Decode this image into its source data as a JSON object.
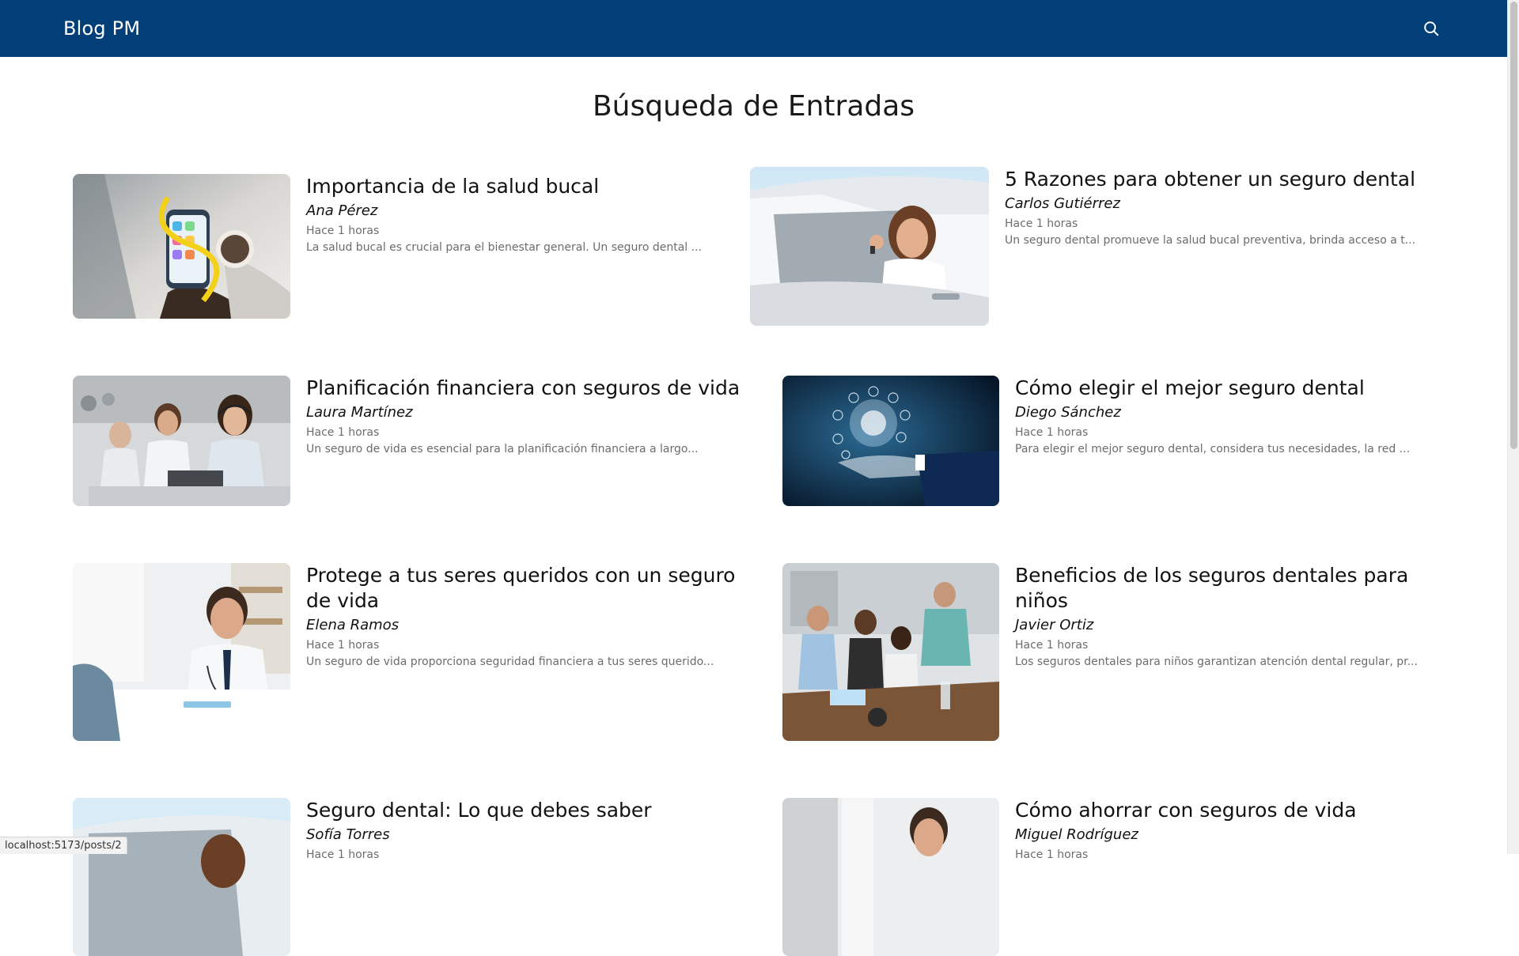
{
  "navbar": {
    "brand": "Blog PM",
    "search_icon": "search-icon",
    "background": "#023f79"
  },
  "page": {
    "title": "Búsqueda de Entradas"
  },
  "posts": [
    {
      "title": "Importancia de la salud bucal",
      "author": "Ana Pérez",
      "time": "Hace 1 horas",
      "excerpt": "La salud bucal es crucial para el bienestar general. Un seguro dental ...",
      "image": "phone-with-app-icons-photo"
    },
    {
      "title": "5 Razones para obtener un seguro dental",
      "author": "Carlos Gutiérrez",
      "time": "Hace 1 horas",
      "excerpt": "Un seguro dental promueve la salud bucal preventiva, brinda acceso a t...",
      "image": "woman-in-car-with-keys-photo"
    },
    {
      "title": "Planificación financiera con seguros de vida",
      "author": "Laura Martínez",
      "time": "Hace 1 horas",
      "excerpt": "Un seguro de vida es esencial para la planificación financiera a largo...",
      "image": "call-center-agents-photo"
    },
    {
      "title": "Cómo elegir el mejor seguro dental",
      "author": "Diego Sánchez",
      "time": "Hace 1 horas",
      "excerpt": "Para elegir el mejor seguro dental, considera tus necesidades, la red ...",
      "image": "hand-with-digital-icons-photo"
    },
    {
      "title": "Protege a tus seres queridos con un seguro de vida",
      "author": "Elena Ramos",
      "time": "Hace 1 horas",
      "excerpt": "Un seguro de vida proporciona seguridad financiera a tus seres querido...",
      "image": "doctor-consultation-photo"
    },
    {
      "title": "Beneficios de los seguros dentales para niños",
      "author": "Javier Ortiz",
      "time": "Hace 1 horas",
      "excerpt": "Los seguros dentales para niños garantizan atención dental regular, pr...",
      "image": "team-meeting-photo"
    },
    {
      "title": "Seguro dental: Lo que debes saber",
      "author": "Sofía Torres",
      "time": "Hace 1 horas",
      "excerpt": "",
      "image": "woman-in-car-photo"
    },
    {
      "title": "Cómo ahorrar con seguros de vida",
      "author": "Miguel Rodríguez",
      "time": "Hace 1 horas",
      "excerpt": "",
      "image": "doctor-photo"
    }
  ],
  "status_bar": {
    "url": "localhost:5173/posts/2"
  }
}
